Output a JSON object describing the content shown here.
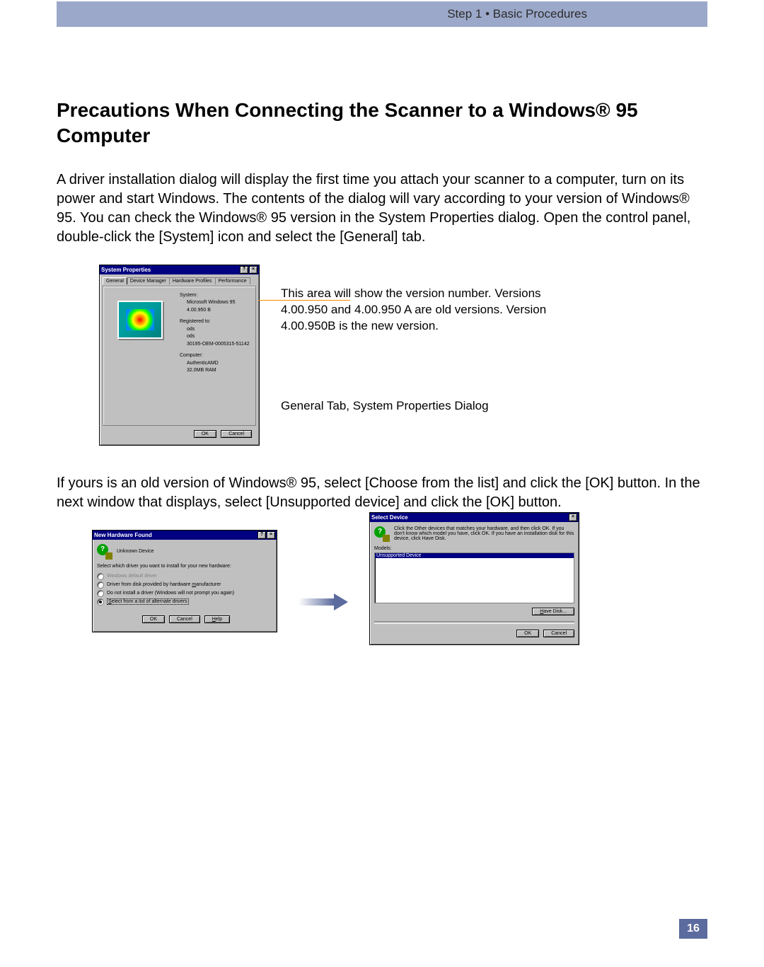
{
  "header": {
    "breadcrumb": "Step 1 • Basic Procedures"
  },
  "title": "Precautions When Connecting the Scanner to a Windows® 95 Computer",
  "para1": "A driver installation dialog will display the first time you attach your scanner to a computer, turn on its power and start Windows. The contents of the dialog will vary according to your version of Windows® 95. You can check the Windows® 95 version in the System Properties dialog. Open the control panel, double-click the [System] icon and select the [General] tab.",
  "annotation": {
    "text": "This area will show the version number. Versions 4.00.950 and 4.00.950 A are old versions. Version 4.00.950B is the new version.",
    "caption": "General Tab, System Properties Dialog"
  },
  "para2": "If yours is an old version of Windows® 95, select [Choose from the list] and click the [OK] button. In the next window that displays, select [Unsupported device] and click the [OK] button.",
  "sysprops": {
    "title": "System Properties",
    "tabs": [
      "General",
      "Device Manager",
      "Hardware Profiles",
      "Performance"
    ],
    "system_label": "System:",
    "system_name": "Microsoft Windows 95",
    "system_version": "4.00.950 B",
    "registered_label": "Registered to:",
    "reg1": "ods",
    "reg2": "ods",
    "reg3": "30195-OEM-0005315-51142",
    "computer_label": "Computer:",
    "cpu": "AuthenticAMD",
    "ram": "32.0MB RAM",
    "ok": "OK",
    "cancel": "Cancel"
  },
  "newhw": {
    "title": "New Hardware Found",
    "device": "Unknown Device",
    "prompt": "Select which driver you want to install for your new hardware:",
    "opt1": "Windows default driver",
    "opt2_pre": "Driver from disk provided by hardware ",
    "opt2_u": "m",
    "opt2_post": "anufacturer",
    "opt3_pre": "Do not install a driver (Windows will not prompt you again)",
    "opt4_u": "S",
    "opt4_post": "elect from a list of alternate drivers",
    "ok": "OK",
    "cancel": "Cancel",
    "help_u": "H",
    "help_post": "elp"
  },
  "selectdev": {
    "title": "Select Device",
    "instruction": "Click the Other devices that matches your hardware, and then click OK. If you don't know which model you have, click OK. If you have an installation disk for this device, click Have Disk.",
    "models_label": "Models:",
    "item": "Unsupported Device",
    "havedisk_u": "H",
    "havedisk_post": "ave Disk...",
    "ok": "OK",
    "cancel": "Cancel"
  },
  "page_number": "16"
}
